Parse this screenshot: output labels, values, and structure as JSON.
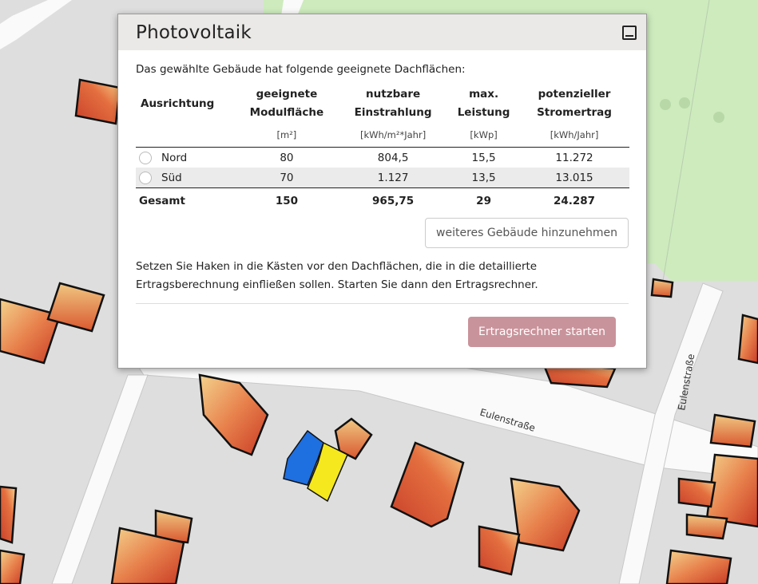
{
  "map": {
    "street_labels": [
      "Eulenstraße",
      "Eulenstraße"
    ]
  },
  "panel": {
    "title": "Photovoltaik",
    "intro": "Das gewählte Gebäude hat folgende geeignete Dachflächen:",
    "table": {
      "headers": [
        {
          "line1": "Ausrichtung",
          "line2": "",
          "unit": ""
        },
        {
          "line1": "geeignete",
          "line2": "Modulfläche",
          "unit": "[m²]"
        },
        {
          "line1": "nutzbare",
          "line2": "Einstrahlung",
          "unit": "[kWh/m²*Jahr]"
        },
        {
          "line1": "max.",
          "line2": "Leistung",
          "unit": "[kWp]"
        },
        {
          "line1": "potenzieller",
          "line2": "Stromertrag",
          "unit": "[kWh/Jahr]"
        }
      ],
      "rows": [
        {
          "name": "Nord",
          "area": "80",
          "irradiation": "804,5",
          "power": "15,5",
          "yield": "11.272"
        },
        {
          "name": "Süd",
          "area": "70",
          "irradiation": "1.127",
          "power": "13,5",
          "yield": "13.015"
        }
      ],
      "total": {
        "name": "Gesamt",
        "area": "150",
        "irradiation": "965,75",
        "power": "29",
        "yield": "24.287"
      }
    },
    "add_building_label": "weiteres Gebäude hinzunehmen",
    "hint": "Setzen Sie Haken in die Kästen vor den Dachflächen, die in die detaillierte Ertragsberechnung einfließen sollen. Starten Sie dann den Ertragsrechner.",
    "start_button_label": "Ertragsrechner starten"
  },
  "colors": {
    "accent_button": "#c9939b",
    "selected_roof_north": "#1e6fe0",
    "selected_roof_south": "#f5e81e"
  }
}
